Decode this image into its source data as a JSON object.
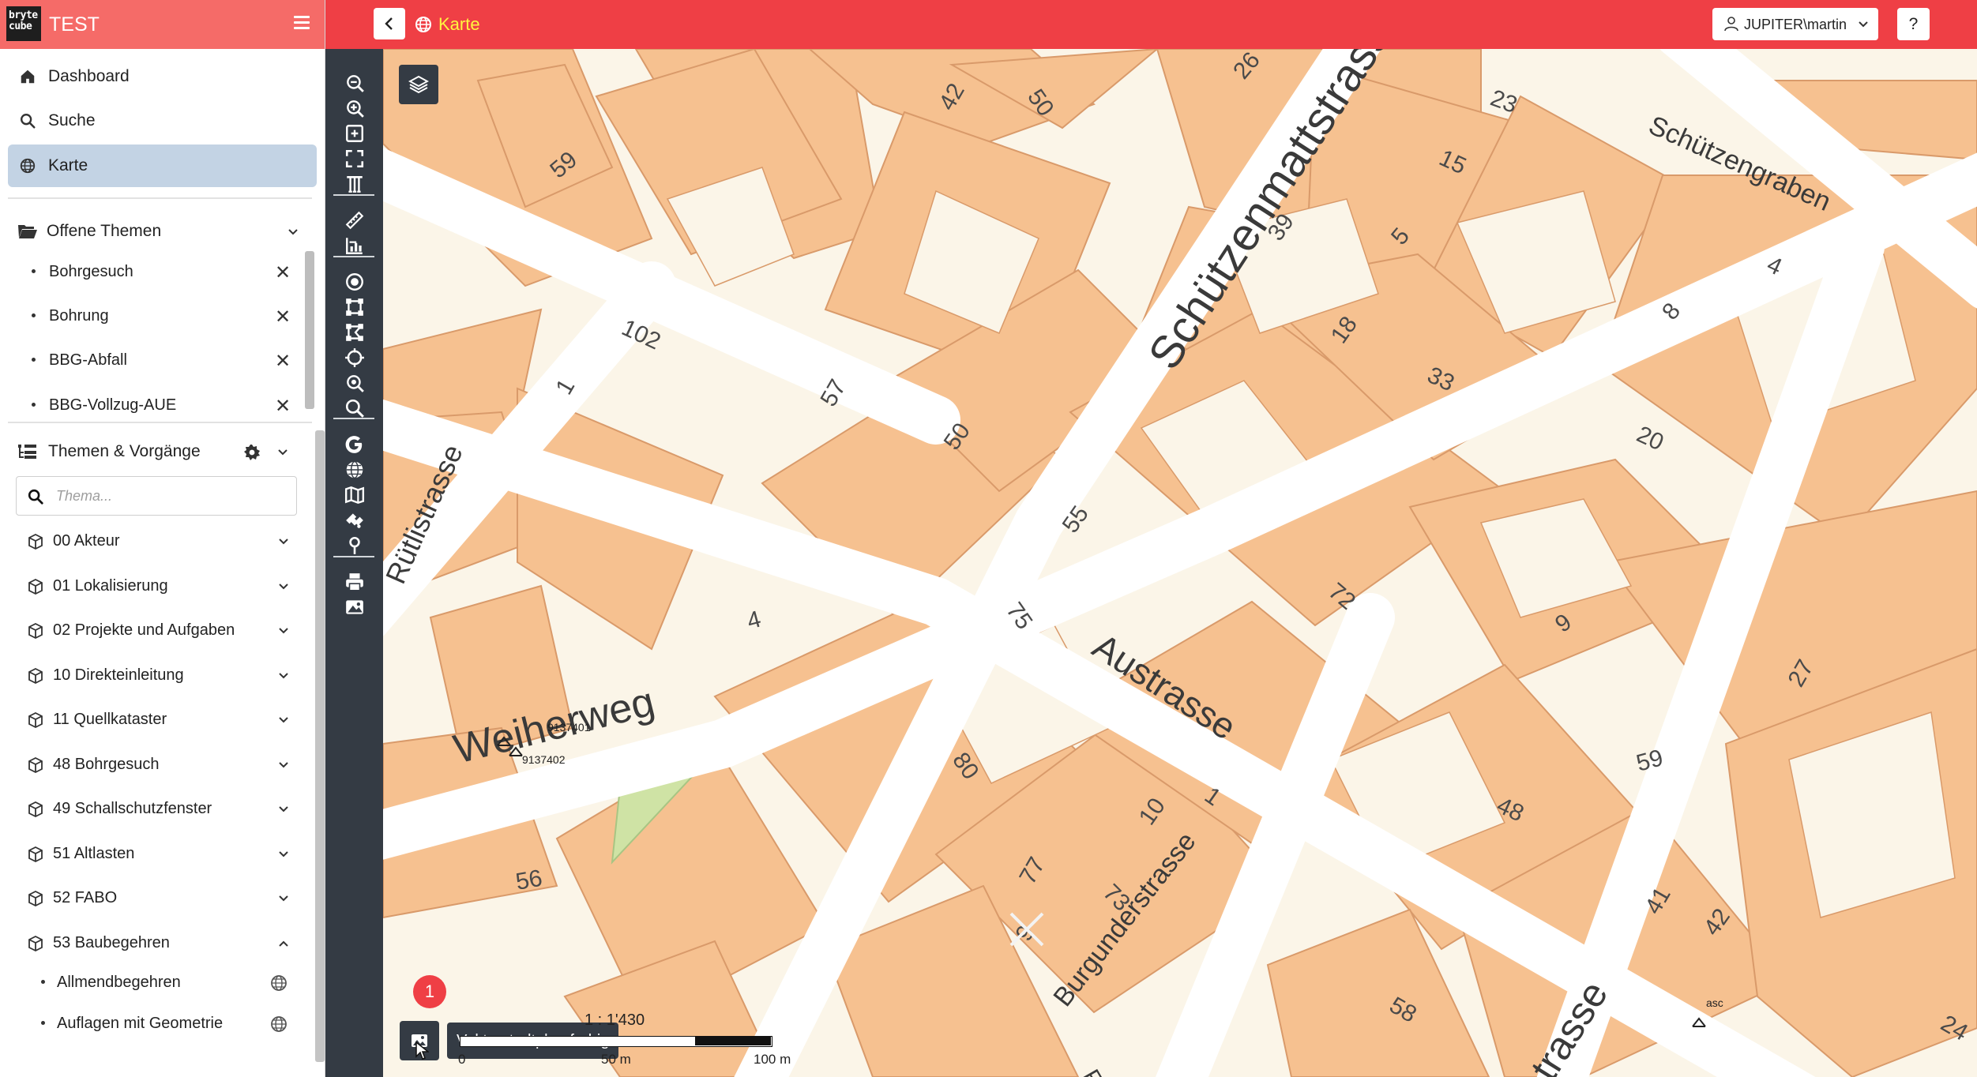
{
  "app": {
    "logo_text": "bryte cube",
    "name": "TEST"
  },
  "nav": [
    {
      "label": "Dashboard",
      "icon": "home-icon"
    },
    {
      "label": "Suche",
      "icon": "search-icon"
    },
    {
      "label": "Karte",
      "icon": "globe-icon",
      "active": true
    }
  ],
  "open_topics": {
    "title": "Offene Themen",
    "items": [
      {
        "label": "Bohrgesuch"
      },
      {
        "label": "Bohrung"
      },
      {
        "label": "BBG-Abfall"
      },
      {
        "label": "BBG-Vollzug-AUE"
      }
    ]
  },
  "themes": {
    "title": "Themen & Vorgänge",
    "search_placeholder": "Thema...",
    "items": [
      {
        "label": "00 Akteur",
        "expanded": false
      },
      {
        "label": "01 Lokalisierung",
        "expanded": false
      },
      {
        "label": "02 Projekte und Aufgaben",
        "expanded": false
      },
      {
        "label": "10 Direkteinleitung",
        "expanded": false
      },
      {
        "label": "11 Quellkataster",
        "expanded": false
      },
      {
        "label": "48 Bohrgesuch",
        "expanded": false
      },
      {
        "label": "49 Schallschutzfenster",
        "expanded": false
      },
      {
        "label": "51 Altlasten",
        "expanded": false
      },
      {
        "label": "52 FABO",
        "expanded": false
      },
      {
        "label": "53 Baubegehren",
        "expanded": true
      }
    ],
    "sub_items": [
      {
        "label": "Allmendbegehren"
      },
      {
        "label": "Auflagen mit Geometrie"
      }
    ]
  },
  "topbar": {
    "page_title": "Karte",
    "user": "JUPITER\\martin",
    "help": "?"
  },
  "tools": [
    "zoom-out-icon",
    "zoom-in-icon",
    "zoom-box-icon",
    "fullscreen-icon",
    "pan-icon",
    "measure-icon",
    "profile-icon",
    "point-icon",
    "polygon-icon",
    "edit-polygon-icon",
    "crosshair-icon",
    "zoom-search-icon",
    "search-icon",
    "google-icon",
    "globe-icon",
    "map-icon",
    "puzzle-icon",
    "pin-icon",
    "print-icon",
    "image-export-icon"
  ],
  "map": {
    "streets": [
      "Schützenmattstrasse",
      "Schützengraben",
      "Austrasse",
      "Weiherweg",
      "Rütlistrasse",
      "Burgunderstrasse",
      "trasse",
      "Fei"
    ],
    "house_numbers": [
      "50",
      "26",
      "23",
      "42",
      "59",
      "102",
      "57",
      "50",
      "39",
      "18",
      "15",
      "5",
      "4",
      "8",
      "20",
      "1",
      "33",
      "55",
      "72",
      "9",
      "4",
      "75",
      "80",
      "10",
      "48",
      "27",
      "59",
      "1",
      "77",
      "73",
      "9",
      "56",
      "58",
      "42",
      "41",
      "24"
    ],
    "point_labels": [
      "9137401",
      "9137402",
      "asc"
    ],
    "basemap_badge": "1",
    "basemap_name": "Vektorstadtplan farbig",
    "scale": "1 : 1'430",
    "scale_ticks": [
      "0",
      "50 m",
      "100 m"
    ]
  },
  "colors": {
    "brand": "#f56b68",
    "topbar": "#ef3f45",
    "title_yellow": "#fff53f",
    "rail": "#343b44",
    "active_nav": "#c3d3e4",
    "building": "#f6c190",
    "building_stroke": "#d99a6a",
    "street": "#ffffff",
    "ground": "#fbf5e8",
    "green": "#cfe3a5"
  }
}
